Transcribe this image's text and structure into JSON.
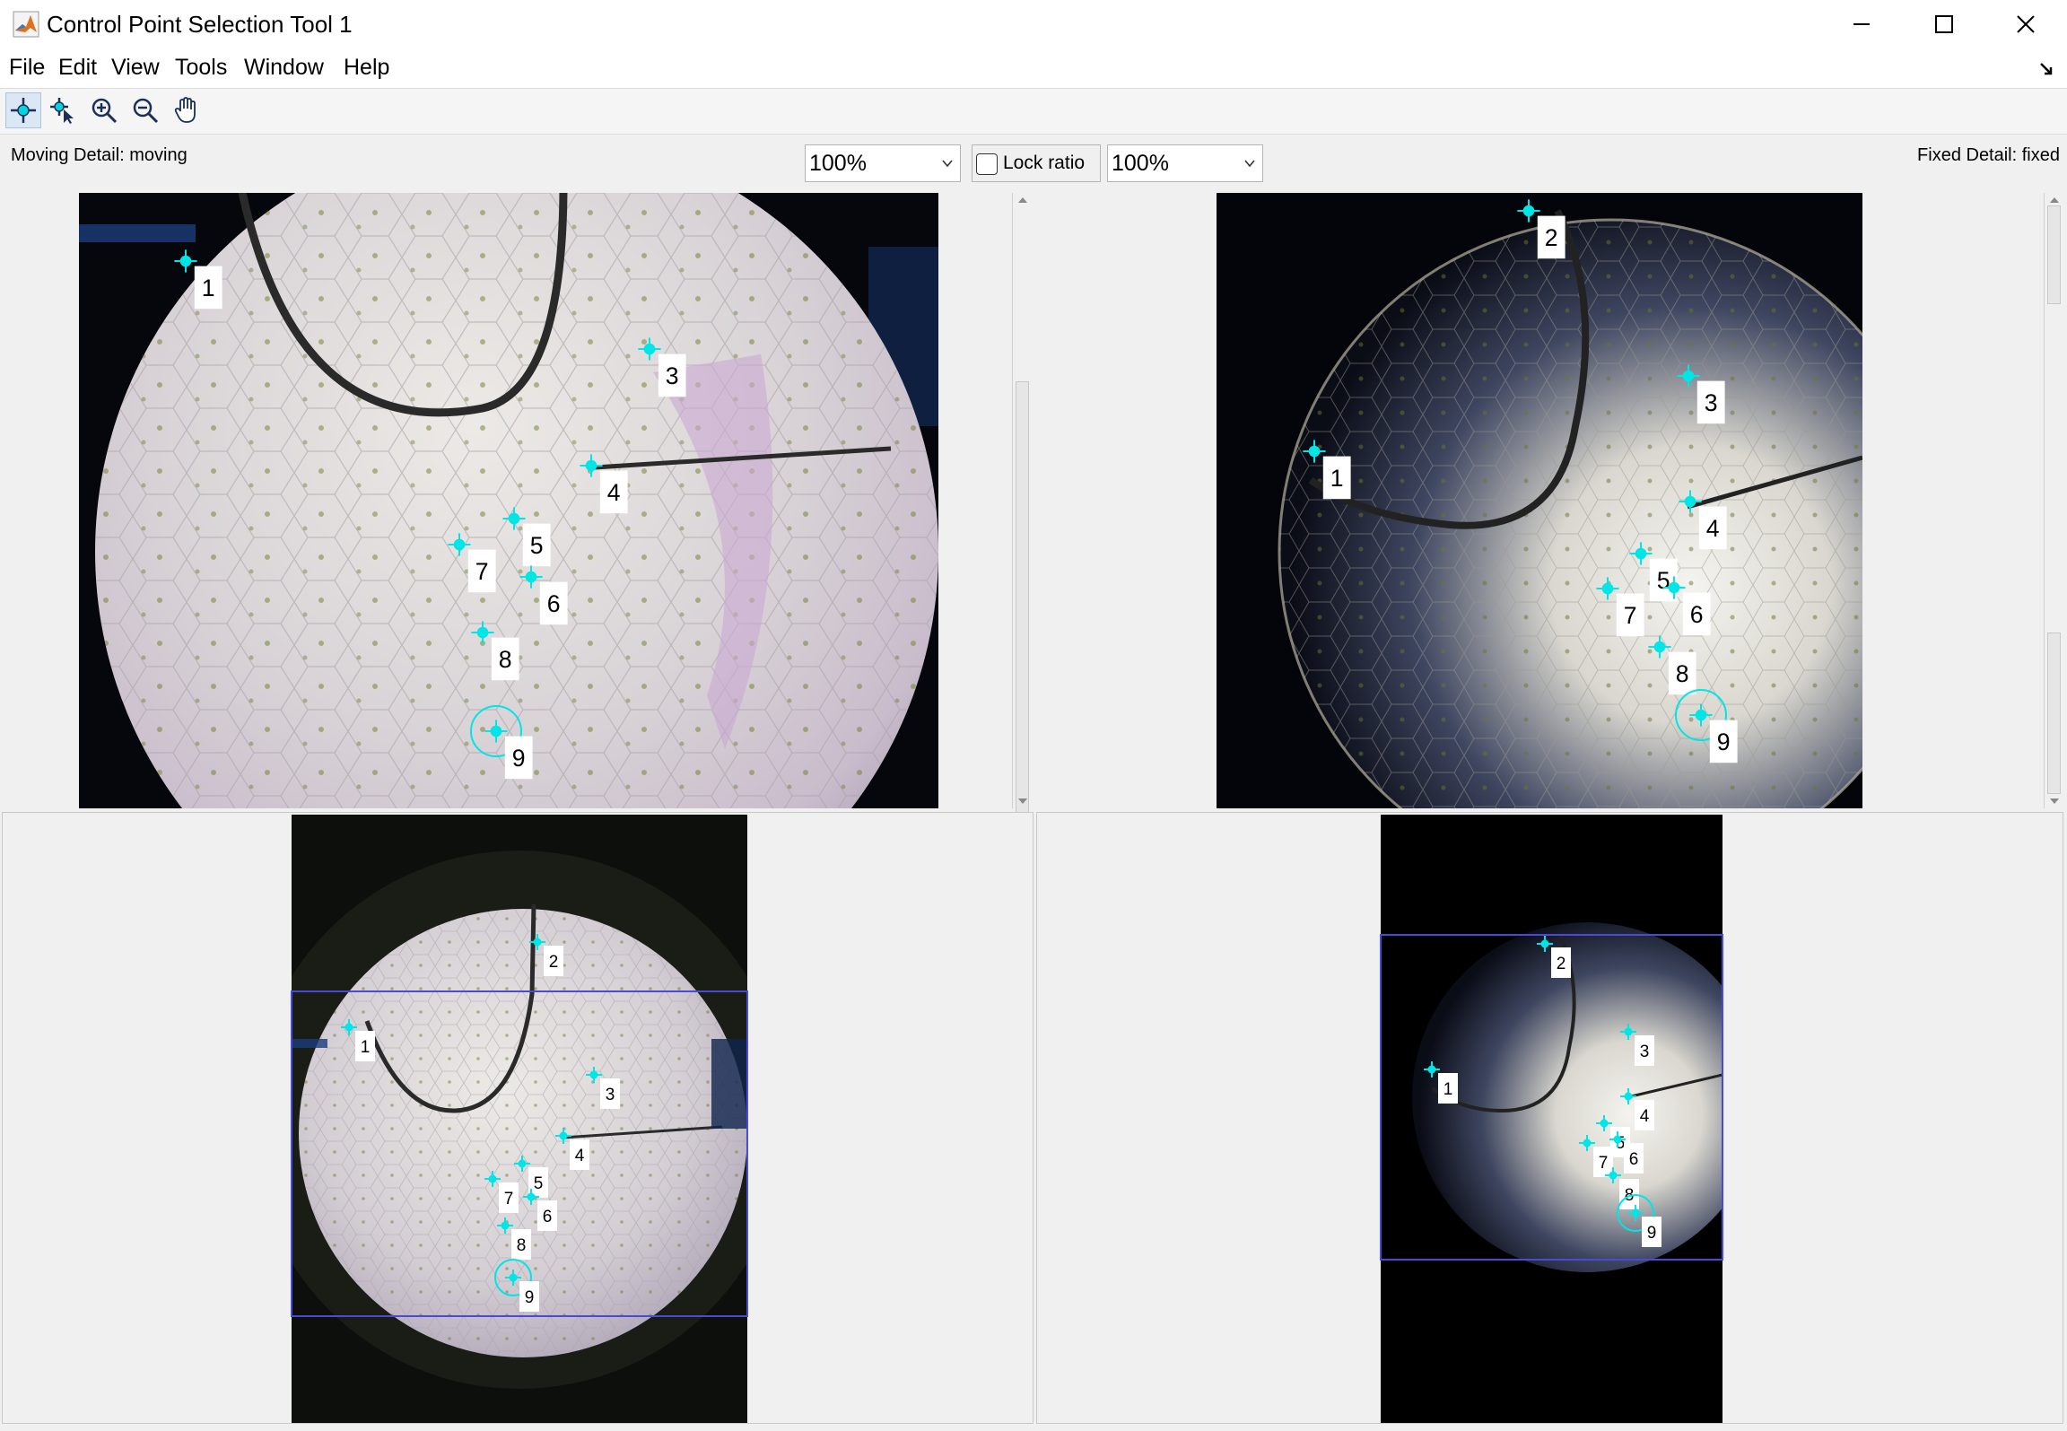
{
  "window": {
    "title": "Control Point Selection Tool 1",
    "app_icon": "matlab-icon",
    "controls": [
      "minimize-icon",
      "maximize-icon",
      "close-icon"
    ]
  },
  "menu": {
    "items": [
      "File",
      "Edit",
      "View",
      "Tools",
      "Window",
      "Help"
    ],
    "undock_icon": "undock-icon"
  },
  "toolbar": {
    "tools": [
      "add-point-icon",
      "select-point-icon",
      "zoom-in-icon",
      "zoom-out-icon",
      "pan-hand-icon"
    ],
    "active_tool": "add-point-icon"
  },
  "moving": {
    "label": "Moving Detail: moving",
    "zoom": "100%"
  },
  "fixed": {
    "label": "Fixed Detail: fixed",
    "zoom": "100%"
  },
  "lock_ratio": {
    "label": "Lock ratio",
    "checked": false
  },
  "points": {
    "labels": [
      "1",
      "2",
      "3",
      "4",
      "5",
      "6",
      "7",
      "8",
      "9"
    ],
    "moving_detail": [
      "1",
      "3",
      "4",
      "5",
      "6",
      "7",
      "8",
      "9"
    ],
    "fixed_detail": [
      "1",
      "2",
      "3",
      "4",
      "5",
      "6",
      "7",
      "8",
      "9"
    ],
    "selected": "9"
  },
  "colors": {
    "point": "#00e5e5",
    "detail_box": "#4a4ad6",
    "label_bg": "#ffffff"
  }
}
